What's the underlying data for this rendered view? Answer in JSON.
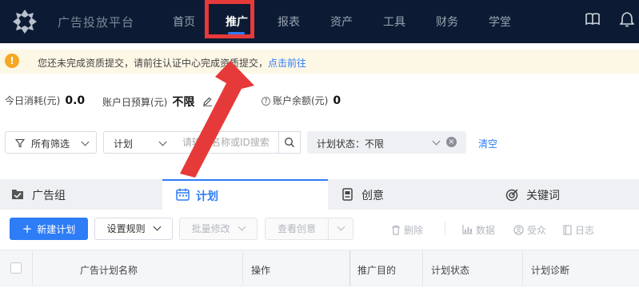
{
  "colors": {
    "nav_bg": "#0c1b33",
    "accent": "#2e7cf6",
    "warning": "#f5a623",
    "annotation": "#e63a3a"
  },
  "header": {
    "brand": "广告投放平台",
    "nav": [
      "首页",
      "推广",
      "报表",
      "资产",
      "工具",
      "财务",
      "学堂"
    ],
    "active_nav": "推广",
    "icons": [
      "book-icon",
      "bell-icon"
    ]
  },
  "notice": {
    "icon": "!",
    "text": "您还未完成资质提交，请前往认证中心完成资质提交，",
    "link": "点击前往"
  },
  "stats": {
    "today_spend_label": "今日消耗(元)",
    "today_spend_value": "0.0",
    "daily_budget_label": "账户日预算(元)",
    "daily_budget_value": "不限",
    "balance_label": "账户余额(元)",
    "balance_value": "0"
  },
  "filters": {
    "all_filter": "所有筛选",
    "scope": "计划",
    "search_placeholder": "请输入名称或ID搜索",
    "status": "计划状态：不限",
    "clear": "清空"
  },
  "tabs": [
    "广告组",
    "计划",
    "创意",
    "关键词"
  ],
  "active_tab": "计划",
  "toolbar": {
    "new_plan": "新建计划",
    "rules": "设置规则",
    "batch_edit": "批量修改",
    "view_creative": "查看创意",
    "delete": "删除",
    "data": "数据",
    "audience": "受众",
    "log": "日志"
  },
  "table": {
    "columns": [
      "广告计划名称",
      "操作",
      "推广目的",
      "计划状态",
      "计划诊断"
    ]
  }
}
